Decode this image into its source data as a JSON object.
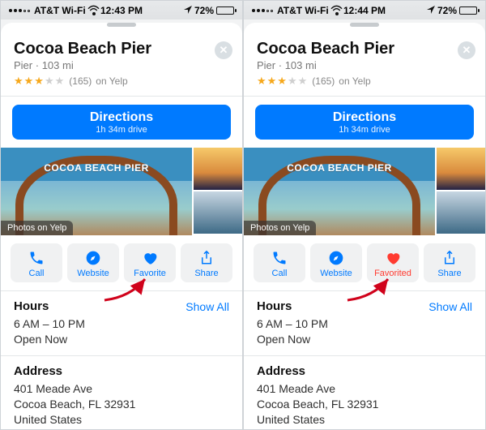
{
  "left": {
    "statusbar": {
      "carrier": "AT&T Wi-Fi",
      "time": "12:43 PM",
      "battery_pct": "72%"
    },
    "place": {
      "name": "Cocoa Beach Pier",
      "category": "Pier",
      "distance": "103 mi",
      "stars_full": 3,
      "stars_empty": 2,
      "rating_count": "(165)",
      "rating_src": "on Yelp",
      "sign_text": "COCOA BEACH PIER",
      "photo_badge": "Photos on Yelp"
    },
    "directions": {
      "label": "Directions",
      "eta": "1h 34m drive"
    },
    "actions": {
      "call": {
        "label": "Call"
      },
      "website": {
        "label": "Website"
      },
      "favorite": {
        "label": "Favorite",
        "favorited": false
      },
      "share": {
        "label": "Share"
      }
    },
    "hours": {
      "title": "Hours",
      "show_all": "Show All",
      "range": "6 AM – 10 PM",
      "status": "Open Now"
    },
    "address": {
      "title": "Address",
      "line1": "401 Meade Ave",
      "line2": "Cocoa Beach, FL  32931",
      "line3": "United States"
    }
  },
  "right": {
    "statusbar": {
      "carrier": "AT&T Wi-Fi",
      "time": "12:44 PM",
      "battery_pct": "72%"
    },
    "place": {
      "name": "Cocoa Beach Pier",
      "category": "Pier",
      "distance": "103 mi",
      "stars_full": 3,
      "stars_empty": 2,
      "rating_count": "(165)",
      "rating_src": "on Yelp",
      "sign_text": "COCOA BEACH PIER",
      "photo_badge": "Photos on Yelp"
    },
    "directions": {
      "label": "Directions",
      "eta": "1h 34m drive"
    },
    "actions": {
      "call": {
        "label": "Call"
      },
      "website": {
        "label": "Website"
      },
      "favorite": {
        "label": "Favorited",
        "favorited": true
      },
      "share": {
        "label": "Share"
      }
    },
    "hours": {
      "title": "Hours",
      "show_all": "Show All",
      "range": "6 AM – 10 PM",
      "status": "Open Now"
    },
    "address": {
      "title": "Address",
      "line1": "401 Meade Ave",
      "line2": "Cocoa Beach, FL  32931",
      "line3": "United States"
    }
  }
}
